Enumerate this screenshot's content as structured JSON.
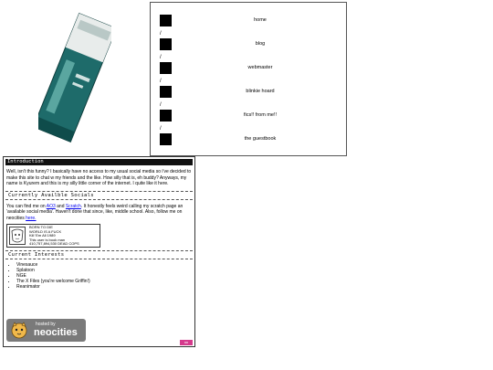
{
  "nav": {
    "items": [
      {
        "label": "home",
        "separator": ""
      },
      {
        "label": "blog",
        "separator": "/"
      },
      {
        "label": "webmaster",
        "separator": "/"
      },
      {
        "label": "blinkie hoard",
        "separator": "/"
      },
      {
        "label": "fics!! from me!!",
        "separator": "/"
      },
      {
        "label": "the guestbook",
        "separator": "/"
      }
    ]
  },
  "panel": {
    "intro_title": "Introduction",
    "intro_text": "Well, isn't this funny? I basically have no access to my usual social media so i've decided to make this site to chat w my friends and the like. How silly that is, eh buddy? Anyways, my name is Kyurem and this is my silly little corner of the internet. I quite like it here.",
    "socials_title": "Currently Availble Socials",
    "socials_pre": "You can find me on ",
    "socials_link1": "AO3",
    "socials_and": " and ",
    "socials_link2": "Scratch",
    "socials_post": ". It honestly feels weird calling my scratch page an 'available social media'. Haven't done that since, like, middle school. Also, follow me on neocities ",
    "socials_link3": "here.",
    "stamp": {
      "line1": "BORN TO DIE",
      "line2": "WORLD IS A FUCK",
      "line3": "Kill 'Em All 1989",
      "line4": "This user is book man",
      "line5": "410,757,894,530 DEAD COPS"
    },
    "interests_title": "Current Interests",
    "interests": [
      "Vinesauce",
      "Splatoon",
      "NGE",
      "The X Files (you're welcome Griffin!)",
      "Reanimator"
    ],
    "badge_small": "hosted by",
    "badge_big": "neocities",
    "corner_text": "nn"
  },
  "colors": {
    "header_bg": "#111111",
    "link": "#0000ee",
    "badge_bg": "#7a7a7a",
    "corner": "#d43a8c"
  }
}
